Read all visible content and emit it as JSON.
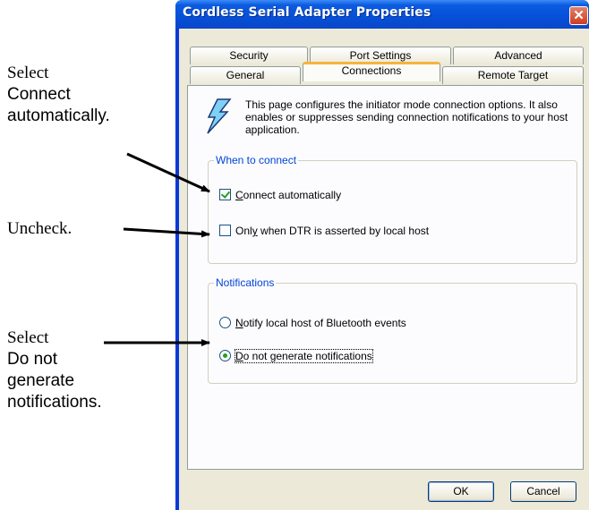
{
  "annotations": {
    "note1": {
      "line1": "Select",
      "line2": "Connect",
      "line3": "automatically."
    },
    "note2": {
      "line1": "Uncheck."
    },
    "note3": {
      "line1": "Select",
      "line2": "Do not",
      "line3": "generate",
      "line4": "notifications."
    }
  },
  "window": {
    "title": "Cordless Serial Adapter Properties",
    "close_glyph": "✕"
  },
  "tabs": {
    "row1": [
      "Security",
      "Port Settings",
      "Advanced"
    ],
    "row2": [
      "General",
      "Connections",
      "Remote Target"
    ],
    "active": "Connections"
  },
  "connections_page": {
    "intro_text": "This page configures the initiator mode connection options. It also enables or suppresses sending connection notifications to your host application.",
    "icon": "lightning-bolt-icon",
    "when_to_connect": {
      "label": "When to connect",
      "connect_automatically": {
        "prefix": "C",
        "rest": "onnect automatically",
        "checked": true
      },
      "only_when_dtr": {
        "prefix": "Onl",
        "accel": "y",
        "rest": " when DTR is asserted by local host",
        "checked": false
      }
    },
    "notifications": {
      "label": "Notifications",
      "notify_bluetooth": {
        "accel": "N",
        "rest": "otify local host of Bluetooth events",
        "selected": false
      },
      "do_not_generate": {
        "accel": "D",
        "rest": "o not generate notifications",
        "selected": true
      }
    }
  },
  "buttons": {
    "ok": "OK",
    "cancel": "Cancel"
  },
  "colors": {
    "title_bar": "#0650d8",
    "accent_tab": "#f6b43c",
    "group_label": "#0046d5",
    "check_green": "#21a121"
  }
}
